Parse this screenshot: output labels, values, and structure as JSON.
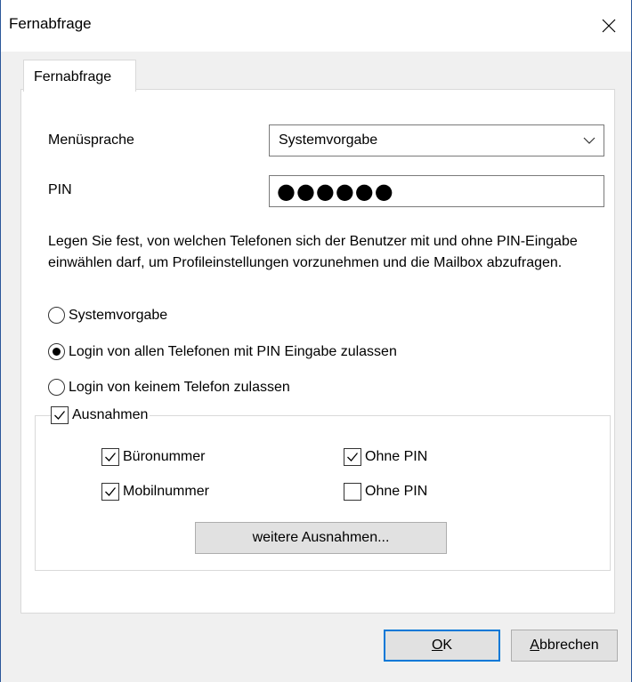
{
  "window": {
    "title": "Fernabfrage"
  },
  "tabs": [
    {
      "label": "Fernabfrage",
      "selected": true
    }
  ],
  "form": {
    "language_label": "Menüsprache",
    "language_value": "Systemvorgabe",
    "pin_label": "PIN",
    "pin_value": "●●●●●●"
  },
  "description": "Legen Sie fest, von welchen Telefonen sich der Benutzer mit und ohne PIN-Eingabe einwählen darf, um Profileinstellungen vorzunehmen und die Mailbox abzufragen.",
  "radios": [
    {
      "label": "Systemvorgabe",
      "checked": false
    },
    {
      "label": "Login von allen Telefonen mit PIN Eingabe zulassen",
      "checked": true
    },
    {
      "label": "Login von keinem Telefon zulassen",
      "checked": false
    }
  ],
  "exceptions": {
    "label": "Ausnahmen",
    "checked": true,
    "office_label": "Büronummer",
    "office_checked": true,
    "office_nopin_label": "Ohne PIN",
    "office_nopin_checked": true,
    "mobile_label": "Mobilnummer",
    "mobile_checked": true,
    "mobile_nopin_label": "Ohne PIN",
    "mobile_nopin_checked": false,
    "more_button": "weitere Ausnahmen..."
  },
  "buttons": {
    "ok_mnemonic": "O",
    "ok_rest": "K",
    "cancel_mnemonic": "A",
    "cancel_rest": "bbrechen"
  },
  "colors": {
    "accent": "#0078d7",
    "frame": "#2b579a"
  }
}
